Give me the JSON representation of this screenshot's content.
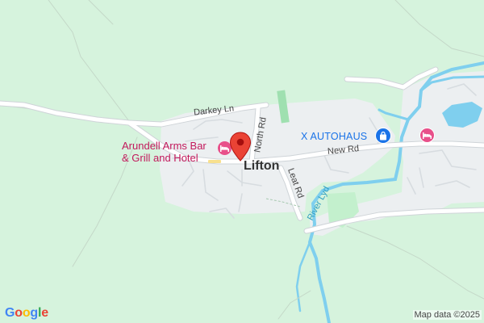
{
  "map": {
    "labels": {
      "darkey_ln": "Darkey Ln",
      "north_rd": "North Rd",
      "new_rd": "New Rd",
      "leat_rd": "Leat Rd",
      "lifton": "Lifton",
      "river_lyd": "River Lyd",
      "hotel_line1": "Arundell Arms Bar",
      "hotel_line2": "& Grill and Hotel",
      "autohaus": "X AUTOHAUS"
    },
    "icons": {
      "hotel": "hotel-bed-icon",
      "shop": "shopping-bag-icon",
      "pin": "red-location-pin-icon"
    },
    "colors": {
      "land": "#d6f3dd",
      "urban": "#eceff1",
      "road": "#ffffff",
      "water": "#7fcfee",
      "park": "#b9ecc4",
      "hotel_pink": "#e8508a",
      "shop_blue": "#1a73e8",
      "pin_red": "#ea4335"
    }
  },
  "footer": {
    "logo_letters": [
      "G",
      "o",
      "o",
      "g",
      "l",
      "e"
    ],
    "logo_colors": [
      "#4285f4",
      "#ea4335",
      "#fbbc05",
      "#4285f4",
      "#34a853",
      "#ea4335"
    ],
    "attribution": "Map data ©2025"
  }
}
